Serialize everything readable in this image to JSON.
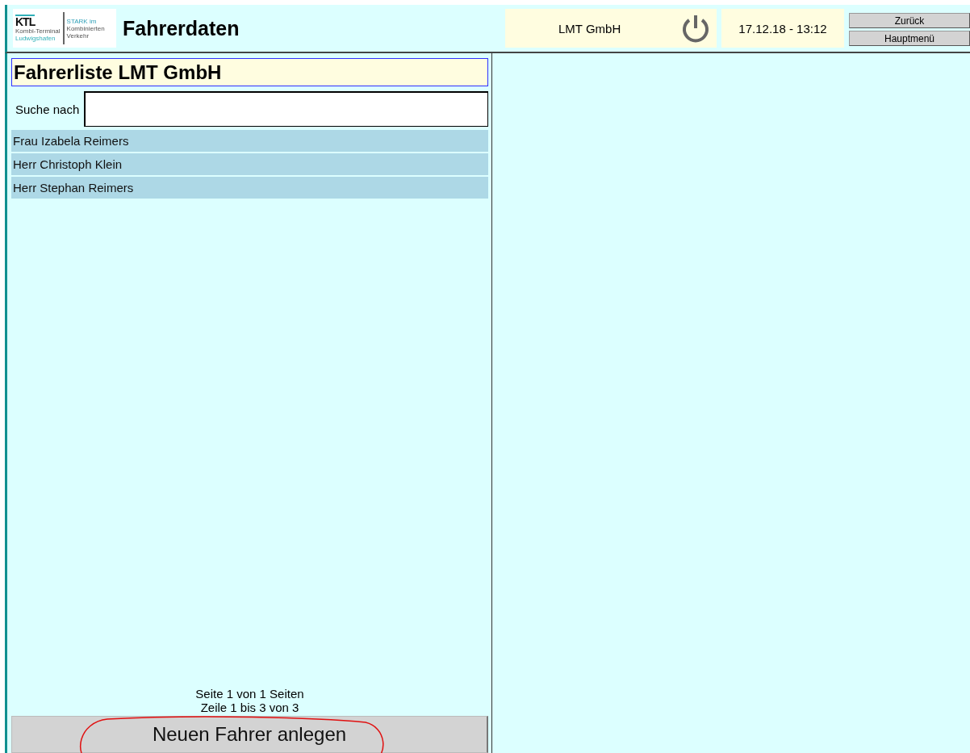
{
  "header": {
    "logo": {
      "mark": "KTL",
      "line_1": "Kombi-Terminal",
      "line_2": "Ludwigshafen",
      "slogan_1": "STARK im",
      "slogan_2": "Kombinierten",
      "slogan_3": "Verkehr"
    },
    "title": "Fahrerdaten",
    "company": "LMT GmbH",
    "datetime": "17.12.18 - 13:12",
    "buttons": [
      "Zurück",
      "Hauptmenü"
    ]
  },
  "list_panel": {
    "title": "Fahrerliste LMT GmbH",
    "search": {
      "label": "Suche nach"
    },
    "rows": [
      {
        "name": "Frau Izabela Reimers"
      },
      {
        "name": "Herr Christoph Klein"
      },
      {
        "name": "Herr Stephan Reimers"
      }
    ],
    "paging": [
      "Seite 1 von 1 Seiten",
      "Zeile 1 bis 3 von 3"
    ],
    "new_button": "Neuen Fahrer anlegen"
  }
}
